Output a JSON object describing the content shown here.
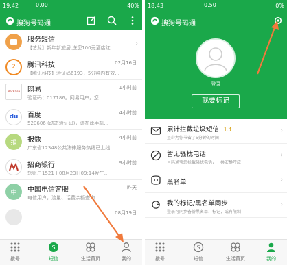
{
  "left": {
    "status": {
      "time": "19:42",
      "network": "0.00",
      "battery": "40%"
    },
    "app_title": "搜狗号码通",
    "messages": [
      {
        "name": "服务短信",
        "snippet": "【艺龙】新年新旅居,送您100元酒店红...",
        "date": "",
        "avatar_text": "",
        "avatar_color": "#f0a14a"
      },
      {
        "name": "腾讯科技",
        "snippet": "【腾讯科技】验证码6193，5分钟内有效...",
        "date": "02月16日",
        "avatar_text": "2",
        "avatar_color": "#ffffff"
      },
      {
        "name": "网易",
        "snippet": "验证码：017186。网易用户，您...",
        "date": "1小时前",
        "avatar_text": "NetEase",
        "avatar_color": "#ffffff"
      },
      {
        "name": "百度",
        "snippet": "520606 (动态验证码)，请在此手机...",
        "date": "4小时前",
        "avatar_text": "du",
        "avatar_color": "#ffffff"
      },
      {
        "name": "报数",
        "snippet": "广东省12348公共法律服务热线已上线...",
        "date": "4小时前",
        "avatar_text": "报",
        "avatar_color": "#b7d97f"
      },
      {
        "name": "招商银行",
        "snippet": "您账户1521于08月23日09:14发生...",
        "date": "9小时前",
        "avatar_text": "招",
        "avatar_color": "#ffffff"
      },
      {
        "name": "中国电信客服",
        "snippet": "电信用户，流量、话费余额查询...",
        "date": "昨天",
        "avatar_text": "中",
        "avatar_color": "#8ed0a6"
      },
      {
        "name": "",
        "snippet": "",
        "date": "08月19日",
        "avatar_text": "",
        "avatar_color": "#ffffff"
      }
    ],
    "tabs": [
      {
        "label": "拨号",
        "active": false
      },
      {
        "label": "短信",
        "active": true
      },
      {
        "label": "生活黄页",
        "active": false
      },
      {
        "label": "我的",
        "active": false
      }
    ]
  },
  "right": {
    "status": {
      "time": "18:43",
      "network": "0.50",
      "battery": "0%"
    },
    "app_title": "搜狗号码通",
    "login_label": "登录",
    "mark_button": "我要标记",
    "menu": [
      {
        "title": "累计拦截垃圾短信",
        "count": "13",
        "desc": "至少为你节省了5分钟的时间"
      },
      {
        "title": "暂无骚扰电话",
        "count": "",
        "desc": "号码通宝您拦截骚扰电话，一共安静呼应"
      },
      {
        "title": "黑名单",
        "count": "",
        "desc": ""
      },
      {
        "title": "我的标记/黑名单同步",
        "count": "",
        "desc": "登录可同步备份黑名单、标记，或有限制"
      }
    ],
    "tabs": [
      {
        "label": "拨号",
        "active": false
      },
      {
        "label": "短信",
        "active": false
      },
      {
        "label": "生活黄页",
        "active": false
      },
      {
        "label": "我的",
        "active": true
      }
    ]
  },
  "colors": {
    "accent": "#1aa84a",
    "arrow": "#f07a3c",
    "count": "#d8a318"
  }
}
